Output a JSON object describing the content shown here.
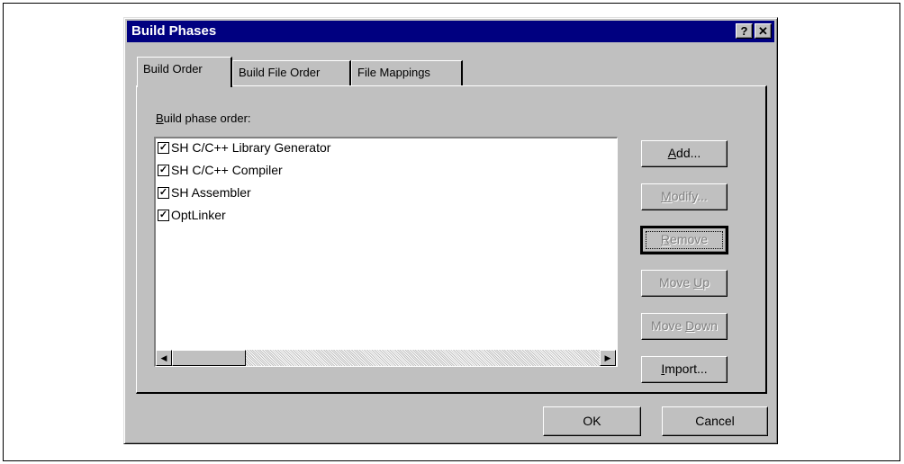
{
  "window": {
    "title": "Build Phases",
    "help_glyph": "?",
    "close_glyph": "✕"
  },
  "tabs": [
    {
      "label": "Build Order",
      "active": true
    },
    {
      "label": "Build File Order",
      "active": false
    },
    {
      "label": "File Mappings",
      "active": false
    }
  ],
  "panel": {
    "label_mnemonic": "B",
    "label_rest": "uild phase order:"
  },
  "build_phases": [
    {
      "label": "SH C/C++ Library Generator",
      "checked": true
    },
    {
      "label": "SH C/C++ Compiler",
      "checked": true
    },
    {
      "label": "SH Assembler",
      "checked": true
    },
    {
      "label": "OptLinker",
      "checked": true
    }
  ],
  "side_buttons": {
    "add": {
      "mnemonic": "A",
      "rest": "dd...",
      "enabled": true
    },
    "modify": {
      "mnemonic": "M",
      "rest": "odify...",
      "enabled": false
    },
    "remove": {
      "mnemonic": "R",
      "rest": "emove",
      "enabled": false
    },
    "move_up": {
      "pre": "Move ",
      "mnemonic": "U",
      "rest": "p",
      "enabled": false
    },
    "move_down": {
      "pre": "Move ",
      "mnemonic": "D",
      "rest": "own",
      "enabled": false
    },
    "import": {
      "mnemonic": "I",
      "rest": "mport...",
      "enabled": true
    }
  },
  "footer": {
    "ok_label": "OK",
    "cancel_label": "Cancel"
  },
  "icons": {
    "scroll_left": "◀",
    "scroll_right": "▶",
    "check": "✓"
  }
}
